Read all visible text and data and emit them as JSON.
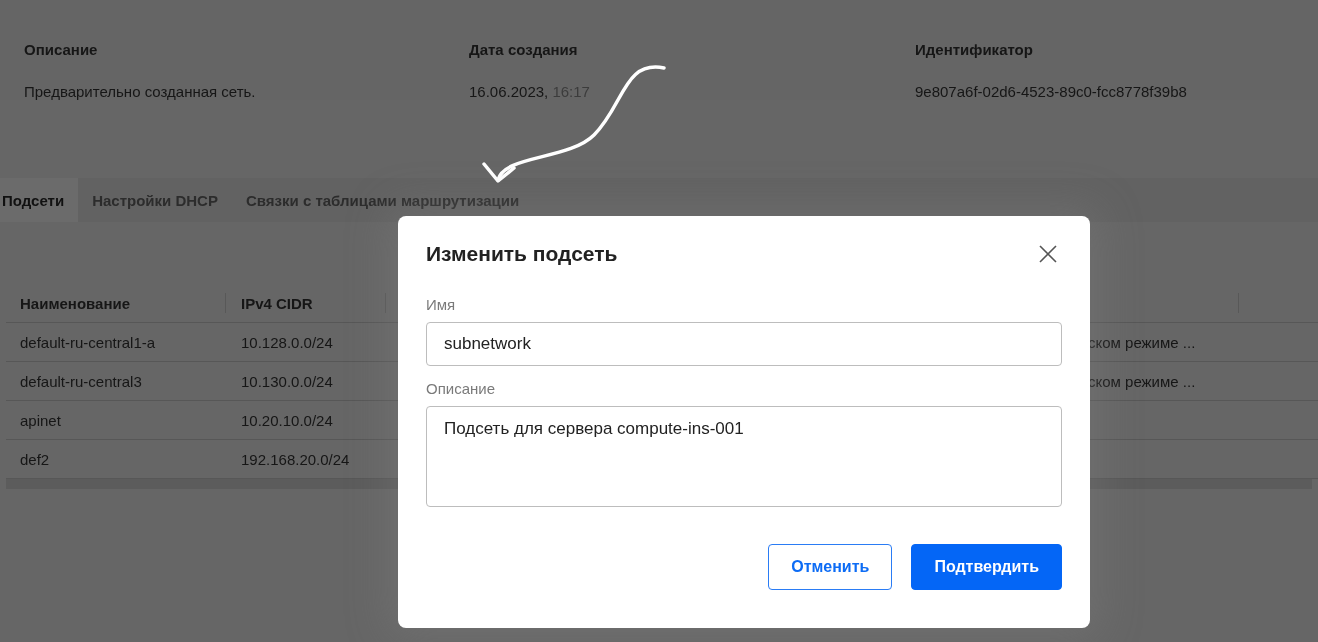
{
  "details": [
    {
      "label": "Описание",
      "value": "Предварительно созданная сеть."
    },
    {
      "label": "Дата создания",
      "value": "16.06.2023,",
      "time": "16:17"
    },
    {
      "label": "Идентификатор",
      "value": "9e807a6f-02d6-4523-89c0-fcc8778f39b8"
    }
  ],
  "tabs": [
    {
      "label": "Подсети",
      "selected": true
    },
    {
      "label": "Настройки DHCP",
      "selected": false
    },
    {
      "label": "Связки с таблицами маршрутизации",
      "selected": false
    }
  ],
  "table": {
    "columns": [
      "Наименование",
      "IPv4 CIDR"
    ],
    "rows": [
      {
        "cells": [
          "default-ru-central1-a",
          "10.128.0.0/24"
        ],
        "column_3": "ском режиме ..."
      },
      {
        "cells": [
          "default-ru-central3",
          "10.130.0.0/24"
        ],
        "column_3": "ском режиме ..."
      },
      {
        "cells": [
          "apinet",
          "10.20.10.0/24"
        ]
      },
      {
        "cells": [
          "def2",
          "192.168.20.0/24"
        ]
      }
    ]
  },
  "modal": {
    "title": "Изменить подсеть",
    "fields": [
      {
        "kind": "input",
        "label": "Имя",
        "value": "subnetwork"
      },
      {
        "kind": "textarea",
        "label": "Описание",
        "value": "Подсеть для сервера compute-ins-001"
      }
    ],
    "buttons": [
      {
        "kind": "secondary",
        "label": "Отменить"
      },
      {
        "kind": "primary",
        "label": "Подтвердить"
      }
    ]
  }
}
